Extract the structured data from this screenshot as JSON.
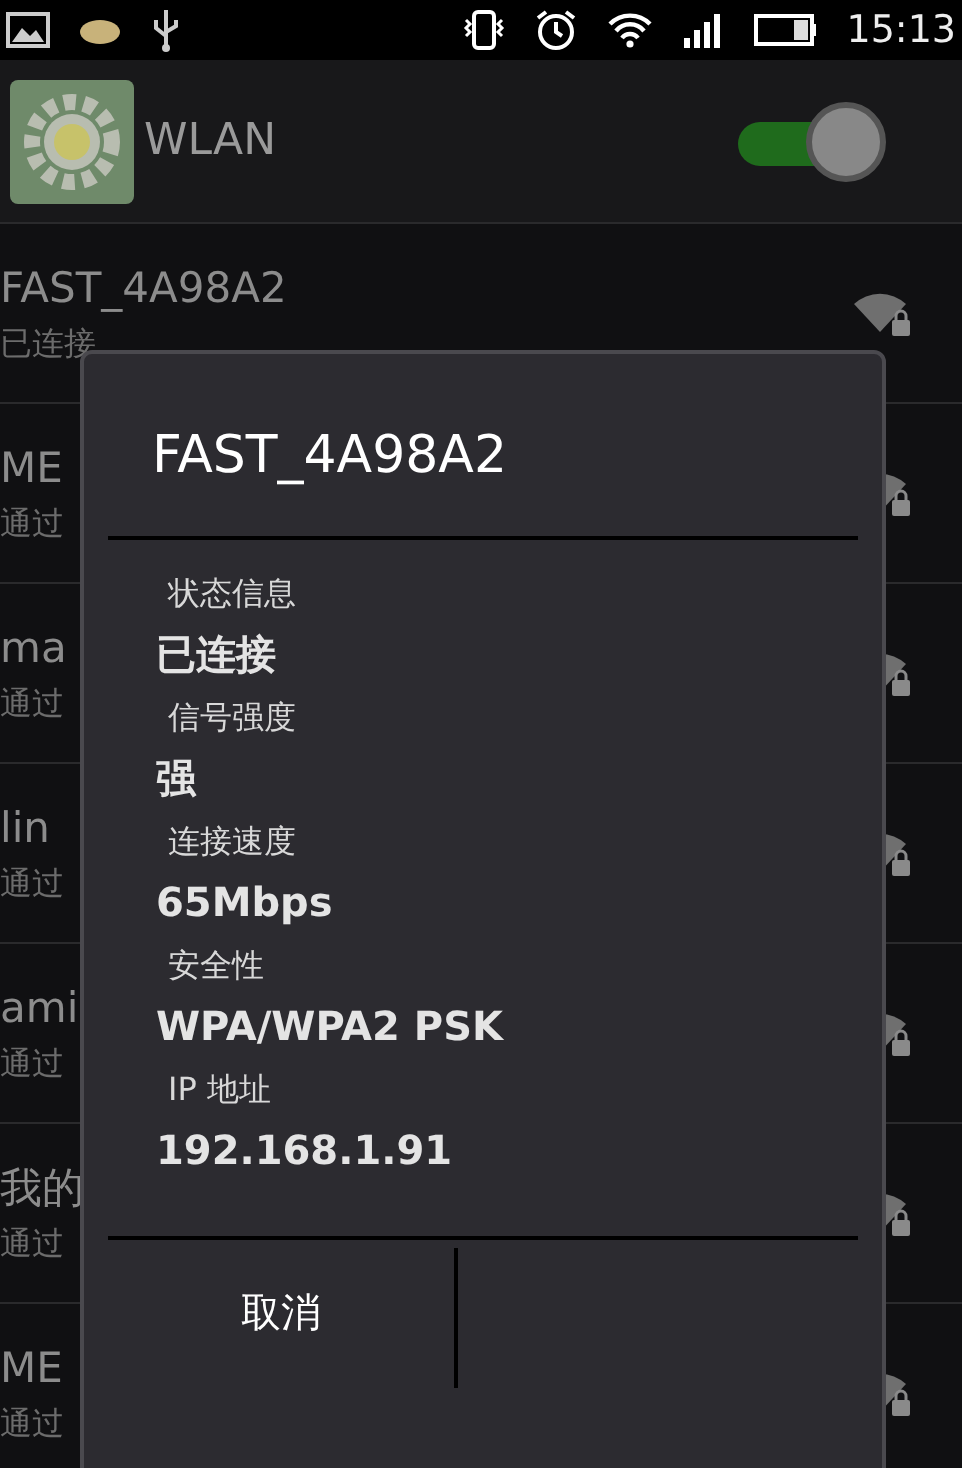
{
  "status_bar": {
    "time": "15:13"
  },
  "header": {
    "title": "WLAN",
    "on": true
  },
  "networks": [
    {
      "name": "FAST_4A98A2",
      "status": "已连接"
    },
    {
      "name": "ME",
      "status": "通过"
    },
    {
      "name": "ma",
      "status": "通过"
    },
    {
      "name": "lin",
      "status": "通过"
    },
    {
      "name": "ami",
      "status": "通过"
    },
    {
      "name": "我的",
      "status": "通过"
    },
    {
      "name": "ME",
      "status": "通过"
    }
  ],
  "dialog": {
    "title": "FAST_4A98A2",
    "fields": [
      {
        "label": "状态信息",
        "value": "已连接"
      },
      {
        "label": "信号强度",
        "value": "强"
      },
      {
        "label": "连接速度",
        "value": "65Mbps"
      },
      {
        "label": "安全性",
        "value": "WPA/WPA2 PSK"
      },
      {
        "label": "IP 地址",
        "value": "192.168.1.91"
      }
    ],
    "buttons": [
      "取消"
    ]
  }
}
